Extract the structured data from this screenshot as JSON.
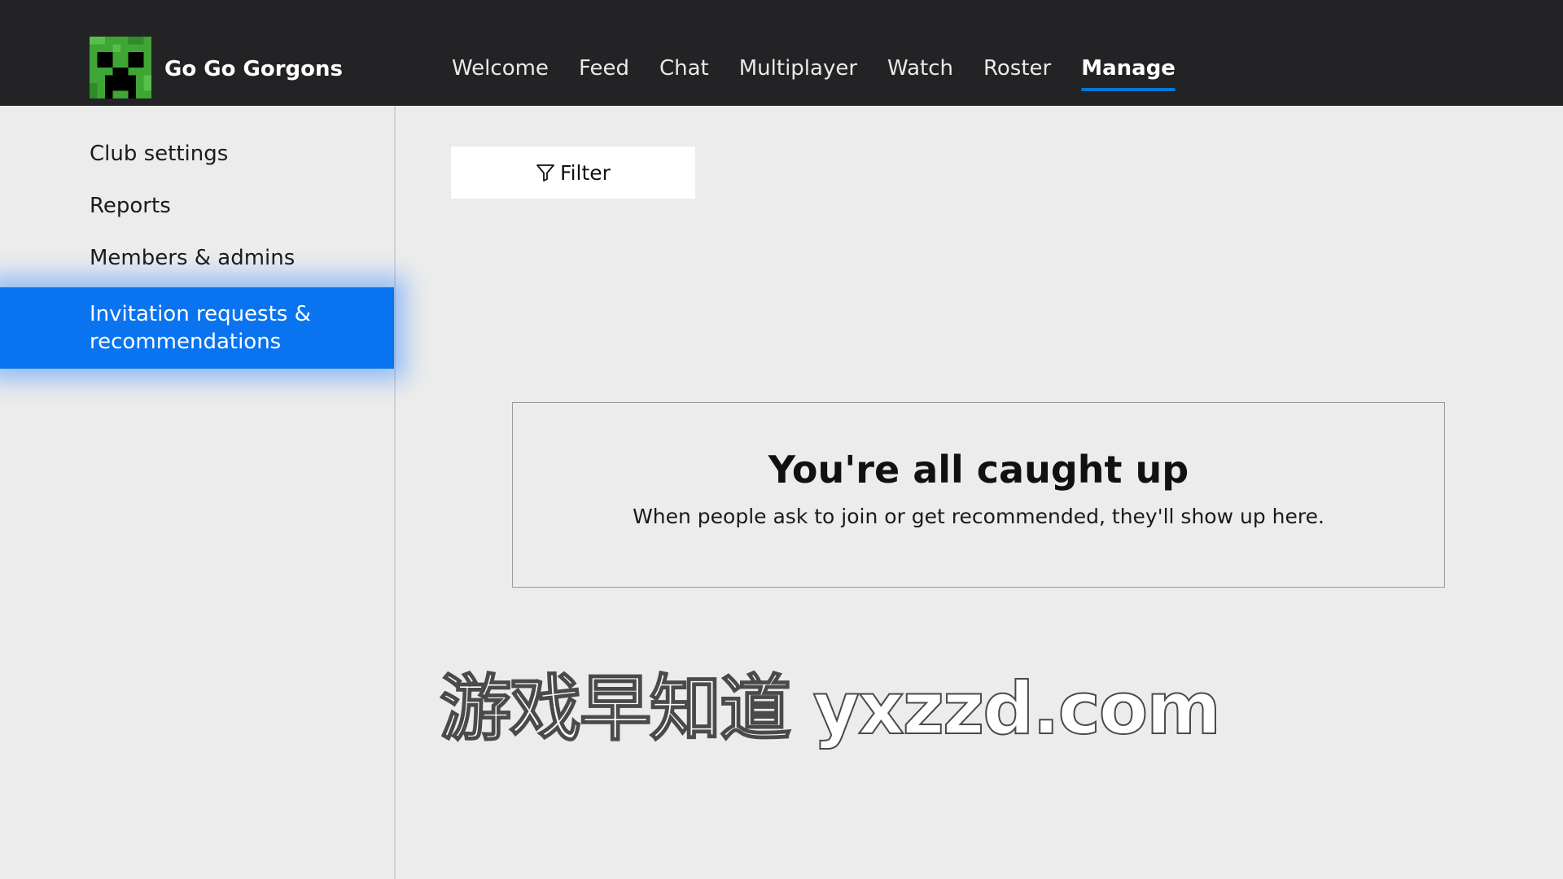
{
  "club": {
    "name": "Go Go Gorgons",
    "logo_icon": "creeper-face-icon",
    "logo_colors": [
      "#3fa535",
      "#000000"
    ]
  },
  "nav": {
    "tabs": [
      {
        "label": "Welcome",
        "active": false
      },
      {
        "label": "Feed",
        "active": false
      },
      {
        "label": "Chat",
        "active": false
      },
      {
        "label": "Multiplayer",
        "active": false
      },
      {
        "label": "Watch",
        "active": false
      },
      {
        "label": "Roster",
        "active": false
      },
      {
        "label": "Manage",
        "active": true
      }
    ],
    "accent_color": "#0078d7"
  },
  "sidebar": {
    "items": [
      {
        "label": "Club settings",
        "active": false
      },
      {
        "label": "Reports",
        "active": false
      },
      {
        "label": "Members & admins",
        "active": false
      },
      {
        "label": "Invitation requests & recommendations",
        "active": true
      }
    ],
    "active_color": "#0a74f0"
  },
  "toolbar": {
    "filter_label": "Filter",
    "filter_icon": "filter-funnel-icon"
  },
  "empty_state": {
    "title": "You're all caught up",
    "subtitle": "When people ask to join or get recommended, they'll show up here."
  },
  "watermark": {
    "text": "游戏早知道 yxzzd.com"
  }
}
